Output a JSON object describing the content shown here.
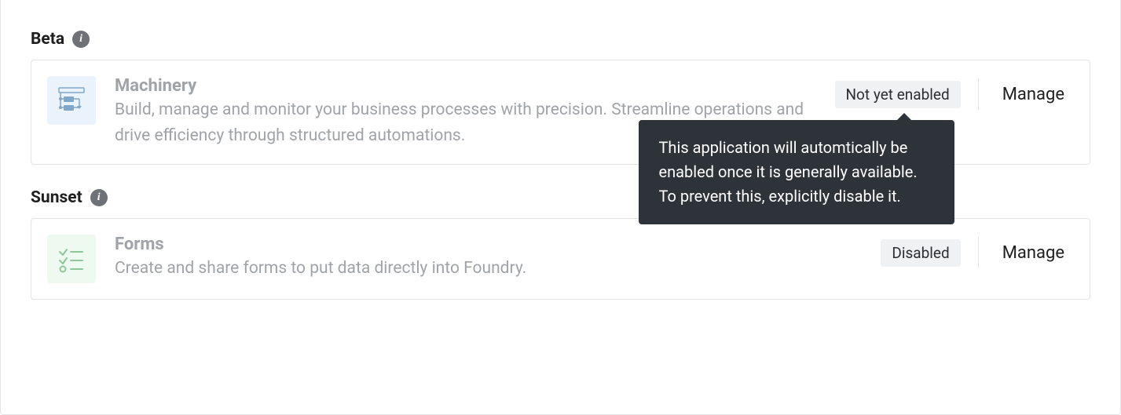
{
  "sections": {
    "beta": {
      "title": "Beta"
    },
    "sunset": {
      "title": "Sunset"
    }
  },
  "apps": {
    "machinery": {
      "title": "Machinery",
      "description": "Build, manage and monitor your business processes with precision. Streamline operations and drive efficiency through structured automations.",
      "status": "Not yet enabled",
      "manage_label": "Manage"
    },
    "forms": {
      "title": "Forms",
      "description": "Create and share forms to put data directly into Foundry.",
      "status": "Disabled",
      "manage_label": "Manage"
    }
  },
  "tooltip": {
    "text": "This application will automtically be enabled once it is generally available. To prevent this, explicitly disable it."
  },
  "info_glyph": "i"
}
